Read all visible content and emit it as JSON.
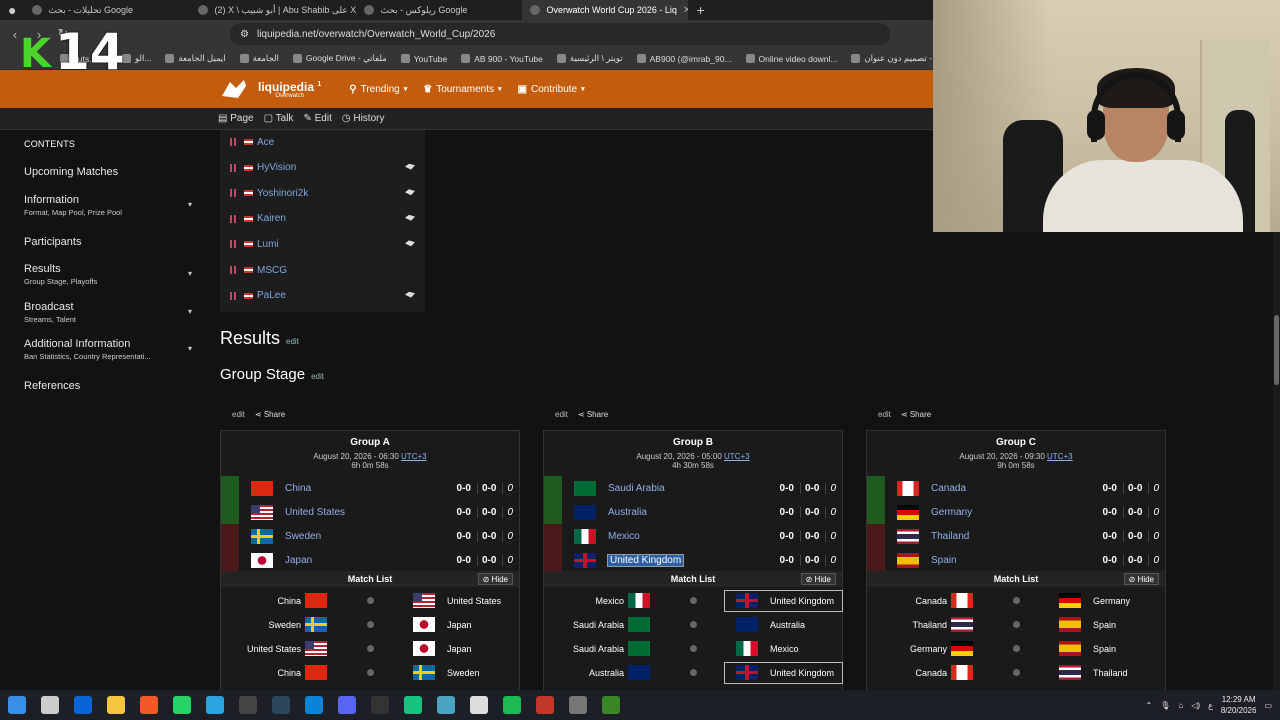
{
  "browser": {
    "tabs": [
      {
        "label": "تحليلات - بحث Google",
        "active": false
      },
      {
        "label": "(2) X \\ أبو شبيب | Abu Shabib على X",
        "active": false
      },
      {
        "label": "ريلوكس - بحث Google",
        "active": false
      },
      {
        "label": "Overwatch World Cup 2026 - Liq",
        "active": true
      }
    ],
    "url": "liquipedia.net/overwatch/Overwatch_World_Cup/2026",
    "bookmarks": [
      "guts.be...",
      "الو...",
      "ايميل الجامعة",
      "الجامعة",
      "Google Drive - ملفاتي",
      "YouTube",
      "AB 900 - YouTube",
      "تويتر \\ الرئيسية",
      "AB900 (@imrab_90...",
      "Online video downl...",
      "تصميم دون عنوان - Y...",
      "Google"
    ]
  },
  "stream_overlay": {
    "letter": "K",
    "number": "14"
  },
  "site": {
    "name": "liquipedia",
    "sub": "Overwatch",
    "badge": "1",
    "nav": [
      "Trending",
      "Tournaments",
      "Contribute"
    ],
    "page_tabs": [
      "Page",
      "Talk",
      "Edit",
      "History"
    ]
  },
  "toc": {
    "title": "CONTENTS",
    "items": [
      {
        "title": "Upcoming Matches",
        "sub": ""
      },
      {
        "title": "Information",
        "sub": "Format, Map Pool, Prize Pool"
      },
      {
        "title": "Participants",
        "sub": ""
      },
      {
        "title": "Results",
        "sub": "Group Stage, Playoffs"
      },
      {
        "title": "Broadcast",
        "sub": "Streams, Talent"
      },
      {
        "title": "Additional Information",
        "sub": "Ban Statistics, Country Representati..."
      },
      {
        "title": "References",
        "sub": ""
      }
    ]
  },
  "players": [
    "Ace",
    "HyVision",
    "Yoshinori2k",
    "Kairen",
    "Lumi",
    "MSCG",
    "PaLee"
  ],
  "headings": {
    "results": "Results",
    "group_stage": "Group Stage",
    "edit": "edit",
    "share": "Share"
  },
  "groups": [
    {
      "title": "Group A",
      "date": "August 20, 2026 - 06:30",
      "tz": "UTC+3",
      "countdown": "6h 0m 58s",
      "teams": [
        {
          "name": "China",
          "flag": "f-china",
          "map": "0-0",
          "games": "0-0",
          "pts": "0",
          "status": "#1f5a1f"
        },
        {
          "name": "United States",
          "flag": "f-us",
          "map": "0-0",
          "games": "0-0",
          "pts": "0",
          "status": "#1f5a1f"
        },
        {
          "name": "Sweden",
          "flag": "f-sweden",
          "map": "0-0",
          "games": "0-0",
          "pts": "0",
          "status": "#4a1a1a"
        },
        {
          "name": "Japan",
          "flag": "f-japan",
          "map": "0-0",
          "games": "0-0",
          "pts": "0",
          "status": "#4a1a1a"
        }
      ],
      "match_list": "Match List",
      "hide": "Hide",
      "matches": [
        {
          "l": "China",
          "lf": "f-china",
          "r": "United States",
          "rf": "f-us",
          "rbox": false
        },
        {
          "l": "Sweden",
          "lf": "f-sweden",
          "r": "Japan",
          "rf": "f-japan",
          "rbox": false
        },
        {
          "l": "United States",
          "lf": "f-us",
          "r": "Japan",
          "rf": "f-japan",
          "rbox": false
        },
        {
          "l": "China",
          "lf": "f-china",
          "r": "Sweden",
          "rf": "f-sweden",
          "rbox": false
        }
      ]
    },
    {
      "title": "Group B",
      "date": "August 20, 2026 - 05:00",
      "tz": "UTC+3",
      "countdown": "4h 30m 58s",
      "teams": [
        {
          "name": "Saudi Arabia",
          "flag": "f-saudi",
          "map": "0-0",
          "games": "0-0",
          "pts": "0",
          "status": "#1f5a1f"
        },
        {
          "name": "Australia",
          "flag": "f-australia",
          "map": "0-0",
          "games": "0-0",
          "pts": "0",
          "status": "#1f5a1f"
        },
        {
          "name": "Mexico",
          "flag": "f-mexico",
          "map": "0-0",
          "games": "0-0",
          "pts": "0",
          "status": "#4a1a1a"
        },
        {
          "name": "United Kingdom",
          "flag": "f-uk",
          "map": "0-0",
          "games": "0-0",
          "pts": "0",
          "status": "#4a1a1a",
          "highlight": true
        }
      ],
      "match_list": "Match List",
      "hide": "Hide",
      "matches": [
        {
          "l": "Mexico",
          "lf": "f-mexico",
          "r": "United Kingdom",
          "rf": "f-uk",
          "rbox": true
        },
        {
          "l": "Saudi Arabia",
          "lf": "f-saudi",
          "r": "Australia",
          "rf": "f-australia",
          "rbox": false
        },
        {
          "l": "Saudi Arabia",
          "lf": "f-saudi",
          "r": "Mexico",
          "rf": "f-mexico",
          "rbox": false
        },
        {
          "l": "Australia",
          "lf": "f-australia",
          "r": "United Kingdom",
          "rf": "f-uk",
          "rbox": true
        }
      ]
    },
    {
      "title": "Group C",
      "date": "August 20, 2026 - 09:30",
      "tz": "UTC+3",
      "countdown": "9h 0m 58s",
      "teams": [
        {
          "name": "Canada",
          "flag": "f-canada",
          "map": "0-0",
          "games": "0-0",
          "pts": "0",
          "status": "#1f5a1f"
        },
        {
          "name": "Germany",
          "flag": "f-germany",
          "map": "0-0",
          "games": "0-0",
          "pts": "0",
          "status": "#1f5a1f"
        },
        {
          "name": "Thailand",
          "flag": "f-thailand",
          "map": "0-0",
          "games": "0-0",
          "pts": "0",
          "status": "#4a1a1a"
        },
        {
          "name": "Spain",
          "flag": "f-spain",
          "map": "0-0",
          "games": "0-0",
          "pts": "0",
          "status": "#4a1a1a"
        }
      ],
      "match_list": "Match List",
      "hide": "Hide",
      "matches": [
        {
          "l": "Canada",
          "lf": "f-canada",
          "r": "Germany",
          "rf": "f-germany",
          "rbox": false
        },
        {
          "l": "Thailand",
          "lf": "f-thailand",
          "r": "Spain",
          "rf": "f-spain",
          "rbox": false
        },
        {
          "l": "Germany",
          "lf": "f-germany",
          "r": "Spain",
          "rf": "f-spain",
          "rbox": false
        },
        {
          "l": "Canada",
          "lf": "f-canada",
          "r": "Thailand",
          "rf": "f-thailand",
          "rbox": false
        }
      ]
    }
  ],
  "taskbar": {
    "icons": [
      "windows-start",
      "search",
      "outlook",
      "file-explorer",
      "brave",
      "whatsapp",
      "telegram",
      "epic-games",
      "steam",
      "edge",
      "discord",
      "obs",
      "app-green",
      "app-blue",
      "chatgpt",
      "spotify",
      "wemod",
      "app-gray",
      "minecraft"
    ],
    "icon_colors": [
      "#3a8ee6",
      "#cccccc",
      "#0a64d6",
      "#f5c542",
      "#f05a28",
      "#25d366",
      "#2aa3de",
      "#444444",
      "#2a475e",
      "#0a84d6",
      "#5865f2",
      "#333333",
      "#19c37d",
      "#4aa3c0",
      "#dddddd",
      "#1db954",
      "#c0392b",
      "#777777",
      "#3c8527"
    ],
    "lang": "ع",
    "time": "12:29 AM",
    "date": "8/20/2026"
  }
}
